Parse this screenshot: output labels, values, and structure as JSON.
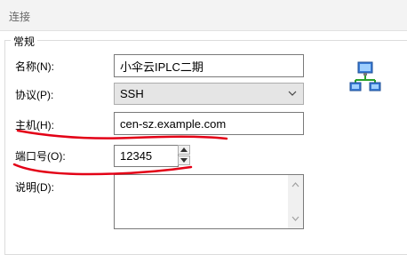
{
  "nav": {
    "connect_label": "连接"
  },
  "group": {
    "title": "常规"
  },
  "form": {
    "name_label": "名称(N):",
    "name_value": "小伞云IPLC二期",
    "protocol_label": "协议(P):",
    "protocol_value": "SSH",
    "host_label": "主机(H):",
    "host_value": "cen-sz.example.com",
    "port_label": "端口号(O):",
    "port_value": "12345",
    "desc_label": "说明(D):",
    "desc_value": ""
  },
  "icons": {
    "protocol_dropdown": "chevron-down-icon",
    "port_up": "spin-up-icon",
    "port_down": "spin-down-icon",
    "connection": "network-computers-icon"
  },
  "colors": {
    "annotation": "#e30016",
    "tree_bg": "#f3f3f3",
    "select_bg": "#e5e5e5"
  }
}
